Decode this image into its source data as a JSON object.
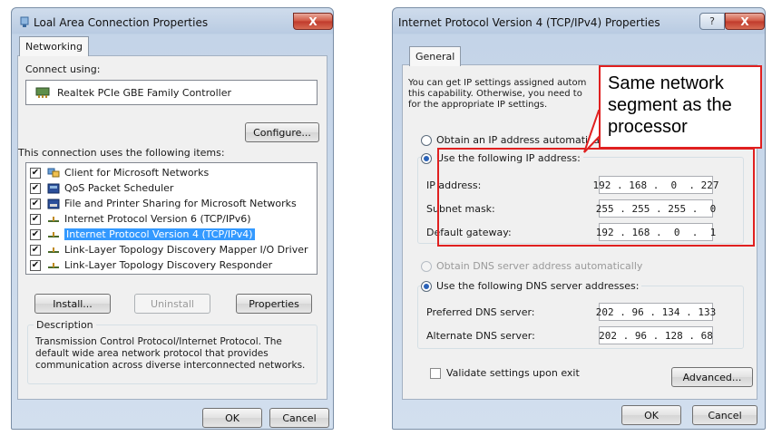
{
  "lan_dialog": {
    "title": "Loal Area Connection Properties",
    "close_glyph": "X",
    "tab": "Networking",
    "connect_using_label": "Connect using:",
    "adapter_name": "Realtek PCIe GBE Family Controller",
    "configure_button": "Configure...",
    "items_label": "This connection uses the following items:",
    "items": [
      {
        "label": "Client for Microsoft Networks",
        "checked": true,
        "icon": "network-client-icon"
      },
      {
        "label": "QoS Packet Scheduler",
        "checked": true,
        "icon": "scheduler-icon"
      },
      {
        "label": "File and Printer Sharing for Microsoft Networks",
        "checked": true,
        "icon": "file-printer-sharing-icon"
      },
      {
        "label": "Internet Protocol Version 6 (TCP/IPv6)",
        "checked": true,
        "icon": "protocol-icon"
      },
      {
        "label": "Internet Protocol Version 4 (TCP/IPv4)",
        "checked": true,
        "icon": "protocol-icon",
        "selected": true
      },
      {
        "label": "Link-Layer Topology Discovery Mapper I/O Driver",
        "checked": true,
        "icon": "protocol-icon"
      },
      {
        "label": "Link-Layer Topology Discovery Responder",
        "checked": true,
        "icon": "protocol-icon"
      }
    ],
    "install_button": "Install...",
    "uninstall_button": "Uninstall",
    "properties_button": "Properties",
    "description_title": "Description",
    "description_text": "Transmission Control Protocol/Internet Protocol. The default wide area network protocol that provides communication across diverse interconnected networks.",
    "ok_button": "OK",
    "cancel_button": "Cancel"
  },
  "ipv4_dialog": {
    "title": "Internet Protocol Version 4 (TCP/IPv4) Properties",
    "help_glyph": "?",
    "close_glyph": "X",
    "tab": "General",
    "info_lines": [
      "You can get IP settings assigned autom",
      "this capability. Otherwise, you need to",
      "for the appropriate IP settings."
    ],
    "obtain_ip_auto": "Obtain an IP address automatically",
    "use_following_ip": "Use the following IP address:",
    "ip_address_label": "IP address:",
    "ip_address_value": "192 . 168 .  0  . 227",
    "subnet_label": "Subnet mask:",
    "subnet_value": "255 . 255 . 255 .  0",
    "gateway_label": "Default gateway:",
    "gateway_value": "192 . 168 .  0  .  1",
    "obtain_dns_auto": "Obtain DNS server address automatically",
    "use_following_dns": "Use the following DNS server addresses:",
    "preferred_dns_label": "Preferred DNS server:",
    "preferred_dns_value": "202 . 96 . 134 . 133",
    "alternate_dns_label": "Alternate DNS server:",
    "alternate_dns_value": "202 . 96 . 128 . 68",
    "validate_label": "Validate settings upon exit",
    "advanced_button": "Advanced...",
    "ok_button": "OK",
    "cancel_button": "Cancel"
  },
  "annotation": {
    "callout_text": "Same network\nsegment as the\nprocessor",
    "highlight_color": "#e02020"
  }
}
